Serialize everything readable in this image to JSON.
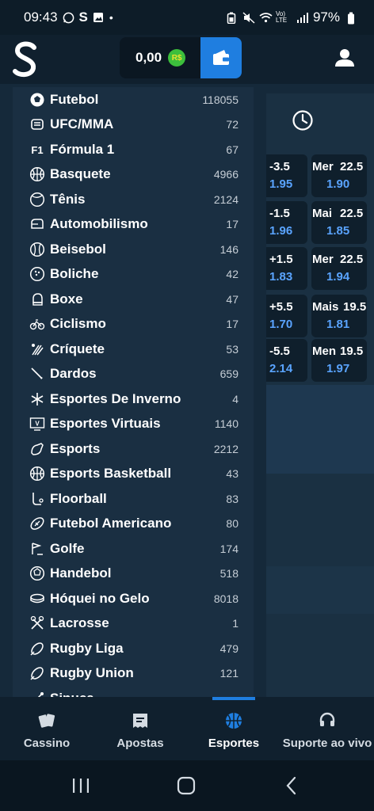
{
  "status_bar": {
    "time": "09:43",
    "letter_s": "S",
    "dot": "•",
    "network": "Vo) LTE",
    "battery": "97%"
  },
  "header": {
    "balance": "0,00",
    "currency": "R$"
  },
  "menu": {
    "items": [
      {
        "icon": "football-icon",
        "label": "Futebol",
        "count": "118055"
      },
      {
        "icon": "ufc-icon",
        "label": "UFC/MMA",
        "count": "72"
      },
      {
        "icon": "f1-icon",
        "label": "Fórmula 1",
        "count": "67",
        "glyph": "F1"
      },
      {
        "icon": "basketball-icon",
        "label": "Basquete",
        "count": "4966"
      },
      {
        "icon": "tennis-icon",
        "label": "Tênis",
        "count": "2124"
      },
      {
        "icon": "motorsport-icon",
        "label": "Automobilismo",
        "count": "17"
      },
      {
        "icon": "baseball-icon",
        "label": "Beisebol",
        "count": "146"
      },
      {
        "icon": "bowling-icon",
        "label": "Boliche",
        "count": "42"
      },
      {
        "icon": "boxing-icon",
        "label": "Boxe",
        "count": "47"
      },
      {
        "icon": "cycling-icon",
        "label": "Ciclismo",
        "count": "17"
      },
      {
        "icon": "cricket-icon",
        "label": "Críquete",
        "count": "53"
      },
      {
        "icon": "darts-icon",
        "label": "Dardos",
        "count": "659"
      },
      {
        "icon": "winter-sports-icon",
        "label": "Esportes De Inverno",
        "count": "4"
      },
      {
        "icon": "virtual-sports-icon",
        "label": "Esportes Virtuais",
        "count": "1140",
        "glyph": "V"
      },
      {
        "icon": "esports-icon",
        "label": "Esports",
        "count": "2212"
      },
      {
        "icon": "esports-basketball-icon",
        "label": "Esports Basketball",
        "count": "43"
      },
      {
        "icon": "floorball-icon",
        "label": "Floorball",
        "count": "83"
      },
      {
        "icon": "american-football-icon",
        "label": "Futebol Americano",
        "count": "80"
      },
      {
        "icon": "golf-icon",
        "label": "Golfe",
        "count": "174"
      },
      {
        "icon": "handball-icon",
        "label": "Handebol",
        "count": "518"
      },
      {
        "icon": "ice-hockey-icon",
        "label": "Hóquei no Gelo",
        "count": "8018"
      },
      {
        "icon": "lacrosse-icon",
        "label": "Lacrosse",
        "count": "1"
      },
      {
        "icon": "rugby-league-icon",
        "label": "Rugby Liga",
        "count": "479"
      },
      {
        "icon": "rugby-union-icon",
        "label": "Rugby Union",
        "count": "121"
      },
      {
        "icon": "snooker-icon",
        "label": "Sinuca",
        "count": ""
      }
    ]
  },
  "odds": [
    {
      "line_a": "-3.5",
      "odd_a": "1.95",
      "label_b": "Mer",
      "line_b": "22.5",
      "odd_b": "1.90"
    },
    {
      "line_a": "-1.5",
      "odd_a": "1.96",
      "label_b": "Mai",
      "line_b": "22.5",
      "odd_b": "1.85"
    },
    {
      "line_a": "+1.5",
      "odd_a": "1.83",
      "label_b": "Mer",
      "line_b": "22.5",
      "odd_b": "1.94"
    },
    {
      "line_a": "+5.5",
      "odd_a": "1.70",
      "label_b": "Mais",
      "line_b": "19.5",
      "odd_b": "1.81"
    },
    {
      "line_a": "-5.5",
      "odd_a": "2.14",
      "label_b": "Men",
      "line_b": "19.5",
      "odd_b": "1.97"
    }
  ],
  "bottom_nav": {
    "casino": "Cassino",
    "bets": "Apostas",
    "sports": "Esportes",
    "support": "Suporte ao vivo"
  },
  "colors": {
    "accent": "#1f7ee0",
    "odd_value": "#5aa4ff",
    "menu_bg": "#1a2f42"
  }
}
